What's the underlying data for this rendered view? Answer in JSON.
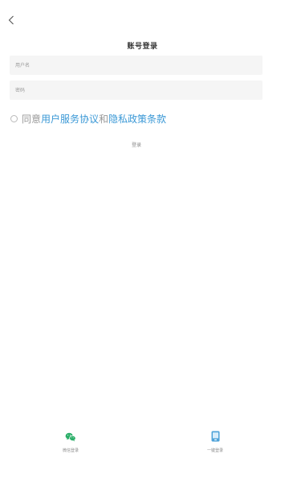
{
  "header": {
    "back_icon": "chevron-left-icon",
    "title": "账号登录"
  },
  "form": {
    "username_placeholder": "用户名",
    "username_value": "",
    "password_placeholder": "密码",
    "password_value": ""
  },
  "agreement": {
    "checked": false,
    "prefix": "同意",
    "user_agreement": "用户服务协议",
    "conjunction": "和",
    "privacy_policy": "隐私政策条款",
    "link_color": "#3a98d6"
  },
  "login": {
    "label": "登录"
  },
  "alt_login": {
    "wechat": {
      "icon": "wechat-icon",
      "label": "微信登录",
      "color": "#2aae67"
    },
    "onekey": {
      "icon": "phone-icon",
      "label": "一键登录",
      "color": "#4fa3d9"
    }
  }
}
